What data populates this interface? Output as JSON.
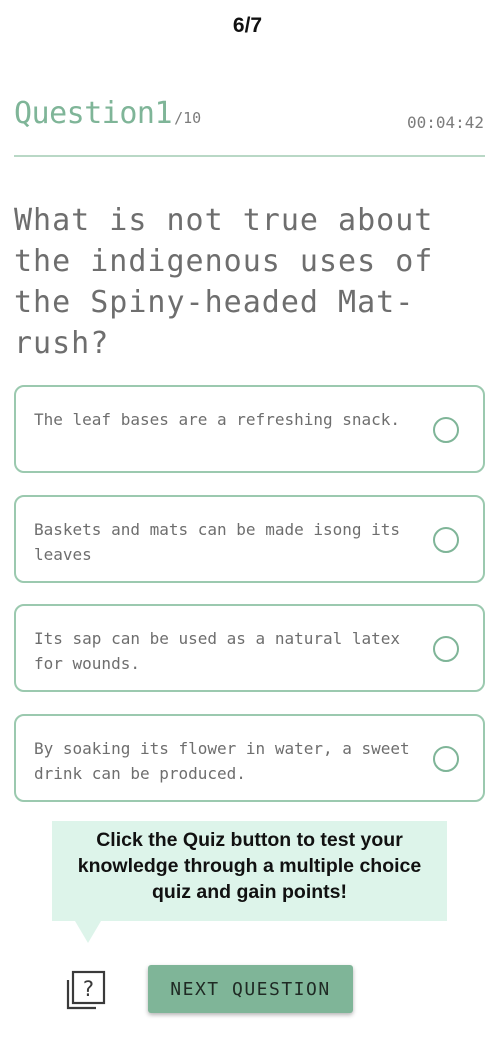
{
  "progress": {
    "step_label": "6/7"
  },
  "question": {
    "title": "Question1",
    "total": "/10",
    "timer": "00:04:42",
    "text": "What is not true about the indigenous uses of the Spiny-headed Mat-rush?"
  },
  "options": [
    {
      "label": "The leaf bases are a refreshing snack.",
      "selected": false
    },
    {
      "label": "Baskets and mats can be made isong its leaves",
      "selected": false
    },
    {
      "label": "Its sap can be used as a natural latex for wounds.",
      "selected": false
    },
    {
      "label": "By soaking its flower in water, a sweet drink can be produced.",
      "selected": false
    }
  ],
  "tooltip": {
    "text": "Click the Quiz button to test your knowledge through a multiple choice quiz and gain points!"
  },
  "footer": {
    "quiz_icon": "quiz-question-icon",
    "next_label": "NEXT QUESTION"
  },
  "colors": {
    "accent": "#7fb598",
    "option_border": "#9bc9af",
    "tooltip_bg": "#ddf4ea",
    "text": "#6e6e6e"
  }
}
